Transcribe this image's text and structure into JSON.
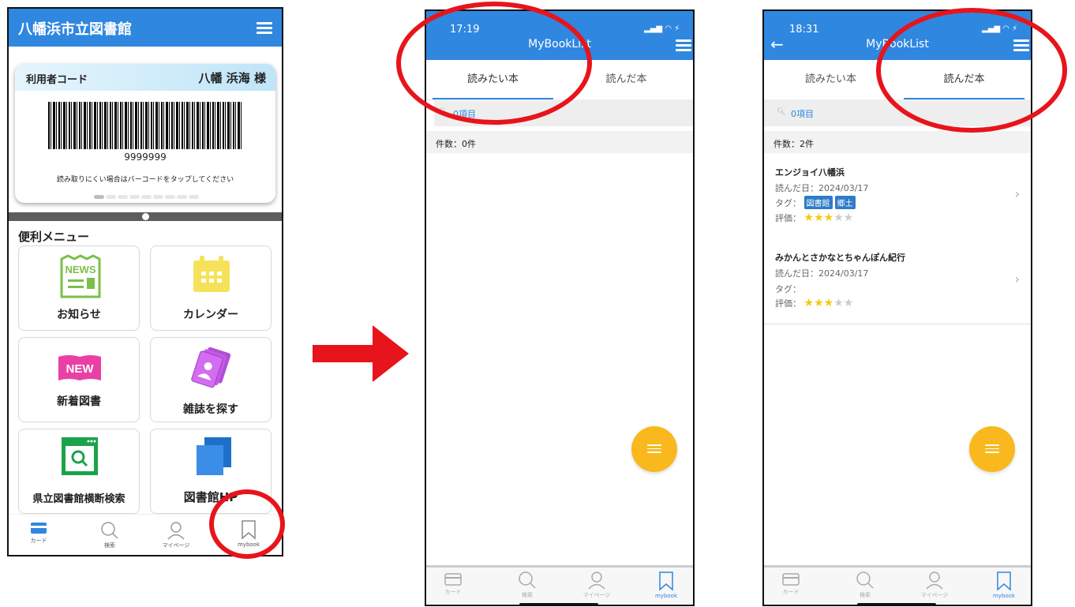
{
  "screen1": {
    "title": "八幡浜市立図書館",
    "card": {
      "label": "利用者コード",
      "name": "八幡 浜海 様",
      "number": "9999999",
      "hint": "読み取りにくい場合はバーコードをタップしてください"
    },
    "menu_heading": "便利メニュー",
    "tiles": [
      {
        "label": "お知らせ",
        "icon": "news-icon"
      },
      {
        "label": "カレンダー",
        "icon": "calendar-icon"
      },
      {
        "label": "新着図書",
        "icon": "new-badge-icon"
      },
      {
        "label": "雑誌を探す",
        "icon": "magazine-icon"
      },
      {
        "label": "県立図書館横断検索",
        "icon": "browser-search-icon"
      },
      {
        "label": "図書館HP",
        "icon": "pages-icon"
      }
    ],
    "news_badge": "NEWS",
    "new_badge": "NEW",
    "nav": [
      "カード",
      "検索",
      "マイページ",
      "mybook"
    ]
  },
  "screen2": {
    "time": "17:19",
    "title": "MyBookList",
    "tabs": [
      "読みたい本",
      "読んだ本"
    ],
    "search": "0項目",
    "count": "件数：0件",
    "nav": [
      "カード",
      "検索",
      "マイページ",
      "mybook"
    ]
  },
  "screen3": {
    "time": "18:31",
    "title": "MyBookList",
    "tabs": [
      "読みたい本",
      "読んだ本"
    ],
    "search": "0項目",
    "count": "件数：2件",
    "items": [
      {
        "title": "エンジョイ八幡浜",
        "date": "読んだ日：2024/03/17",
        "tag_label": "タグ：",
        "tags": [
          "図書館",
          "郷土"
        ],
        "rating_label": "評価：",
        "rating": 3
      },
      {
        "title": "みかんとさかなとちゃんぽん紀行",
        "date": "読んだ日：2024/03/17",
        "tag_label": "タグ：",
        "tags": [],
        "rating_label": "評価：",
        "rating": 3
      }
    ],
    "nav": [
      "カード",
      "検索",
      "マイページ",
      "mybook"
    ]
  },
  "colors": {
    "header": "#2f87e0",
    "fab": "#f9b91e",
    "annotation": "#e8141b",
    "star_on": "#f6c90e",
    "star_off": "#cccccc"
  }
}
